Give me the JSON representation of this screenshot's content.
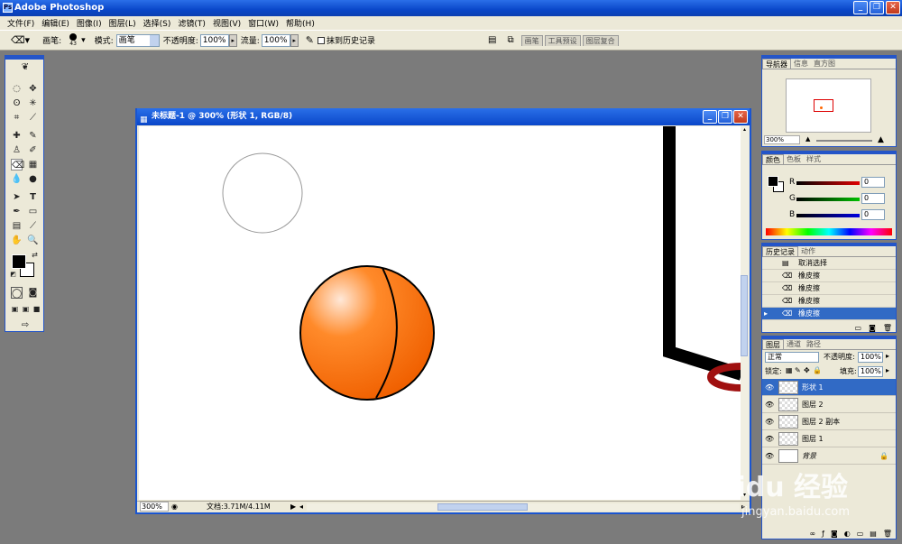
{
  "app": {
    "title": "Adobe Photoshop",
    "window_buttons": [
      "_",
      "❐",
      "✕"
    ]
  },
  "menu": [
    "文件(F)",
    "编辑(E)",
    "图像(I)",
    "图层(L)",
    "选择(S)",
    "滤镜(T)",
    "视图(V)",
    "窗口(W)",
    "帮助(H)"
  ],
  "options": {
    "brush_label": "画笔:",
    "brush_size": "43",
    "mode_label": "模式:",
    "mode_value": "画笔",
    "opacity_label": "不透明度:",
    "opacity_value": "100%",
    "flow_label": "流量:",
    "flow_value": "100%",
    "erase_history_label": "抹到历史记录",
    "palette_tabs": [
      "画笔",
      "工具预设",
      "图层复合"
    ]
  },
  "document": {
    "title": "未标题-1 @ 300% (形状 1, RGB/8)",
    "zoom": "300%",
    "doc_size": "文档:3.71M/4.11M"
  },
  "navigator": {
    "tabs": [
      "导航器",
      "信息",
      "直方图"
    ],
    "zoom": "300%"
  },
  "color": {
    "tabs": [
      "颜色",
      "色板",
      "样式"
    ],
    "channels": [
      {
        "label": "R",
        "value": "0",
        "color": "#e00000"
      },
      {
        "label": "G",
        "value": "0",
        "color": "#00a000"
      },
      {
        "label": "B",
        "value": "0",
        "color": "#0000d0"
      }
    ]
  },
  "history": {
    "tabs": [
      "历史记录",
      "动作"
    ],
    "items": [
      "取消选择",
      "橡皮擦",
      "橡皮擦",
      "橡皮擦",
      "橡皮擦"
    ]
  },
  "layers": {
    "tabs": [
      "图层",
      "通道",
      "路径"
    ],
    "blend_mode": "正常",
    "opacity_label": "不透明度:",
    "opacity_value": "100%",
    "lock_label": "锁定:",
    "fill_label": "填充:",
    "fill_value": "100%",
    "items": [
      "形状 1",
      "图层 2",
      "图层 2 副本",
      "图层 1",
      "背景"
    ]
  },
  "watermark": {
    "brand": "Baidu 经验",
    "url": "jingyan.baidu.com"
  },
  "colors": {
    "xp_blue": "#0a47c9",
    "basketball": "#ff6a00",
    "selection": "#316ac5"
  }
}
